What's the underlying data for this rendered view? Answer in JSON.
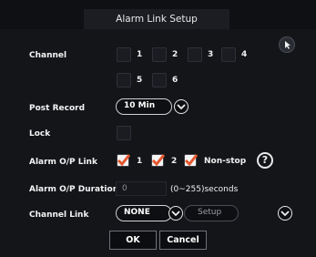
{
  "window": {
    "title": "Alarm Link Setup"
  },
  "channel": {
    "label": "Channel",
    "options": [
      {
        "num": "1",
        "checked": false
      },
      {
        "num": "2",
        "checked": false
      },
      {
        "num": "3",
        "checked": false
      },
      {
        "num": "4",
        "checked": false
      },
      {
        "num": "5",
        "checked": false
      },
      {
        "num": "6",
        "checked": false
      }
    ]
  },
  "post_record": {
    "label": "Post Record",
    "value": "10 Min"
  },
  "lock": {
    "label": "Lock",
    "checked": false
  },
  "alarm_op_link": {
    "label": "Alarm O/P Link",
    "options": [
      {
        "text": "1",
        "checked": true
      },
      {
        "text": "2",
        "checked": true
      },
      {
        "text": "Non-stop",
        "checked": true
      }
    ]
  },
  "alarm_op_duration": {
    "label": "Alarm O/P Duration",
    "value": "0",
    "range": "(0~255)seconds"
  },
  "channel_link": {
    "label": "Channel Link",
    "value": "NONE",
    "setup_label": "Setup"
  },
  "buttons": {
    "ok": "OK",
    "cancel": "Cancel"
  },
  "icons": {
    "help": "?",
    "mouse": "mouse-icon",
    "chevron": "chevron-down-icon",
    "check": "checkmark-icon"
  },
  "colors": {
    "check_mark": "#e4572e",
    "background": "#141519"
  }
}
